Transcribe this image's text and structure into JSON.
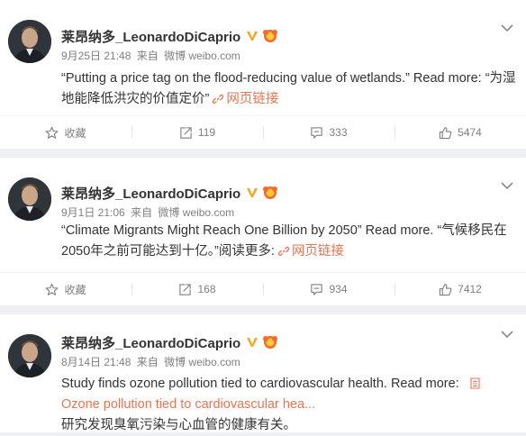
{
  "posts": [
    {
      "author": "莱昂纳多_LeonardoDiCaprio",
      "time": "9月25日 21:48",
      "from_label": "来自",
      "source": "微博 weibo.com",
      "text_before": "“Putting a price tag on the flood-reducing value of wetlands.” Read more: “为湿地能降低洪灾的价值定价”",
      "link_label": "网页链接",
      "actions": {
        "favorite": "收藏",
        "repost": "119",
        "comment": "333",
        "like": "5474"
      }
    },
    {
      "author": "莱昂纳多_LeonardoDiCaprio",
      "time": "9月1日 21:06",
      "from_label": "来自",
      "source": "微博 weibo.com",
      "text_before": "“Climate Migrants Might Reach One Billion by 2050” Read more. “气候移民在2050年之前可能达到十亿。”阅读更多:",
      "link_label": "网页链接",
      "actions": {
        "favorite": "收藏",
        "repost": "168",
        "comment": "934",
        "like": "7412"
      }
    },
    {
      "author": "莱昂纳多_LeonardoDiCaprio",
      "time": "8月14日 21:48",
      "from_label": "来自",
      "source": "微博 weibo.com",
      "text_before": "Study finds ozone pollution tied to cardiovascular health. Read more:",
      "link_label": "Ozone pollution tied to cardiovascular hea...",
      "text_after": "研究发现臭氧污染与心血管的健康有关。"
    }
  ],
  "colors": {
    "link": "#eb7350",
    "verified_badge": "#f5a623",
    "meta_text": "#808080",
    "feed_bg": "#eef0f3"
  },
  "icons": {
    "favorite": "star-icon",
    "repost": "repost-icon",
    "comment": "comment-icon",
    "like": "thumbs-up-icon",
    "link": "link-icon",
    "menu": "chevron-down-icon"
  }
}
